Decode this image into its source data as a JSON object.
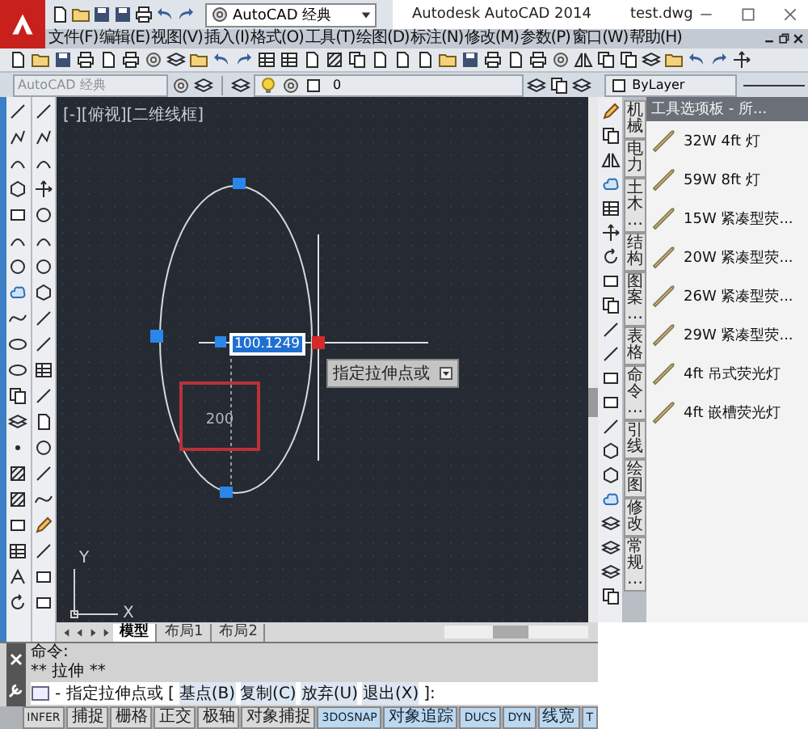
{
  "app": {
    "workspace": "AutoCAD 经典",
    "title": "Autodesk AutoCAD 2014",
    "file": "test.dwg"
  },
  "menu": [
    "文件(F)",
    "编辑(E)",
    "视图(V)",
    "插入(I)",
    "格式(O)",
    "工具(T)",
    "绘图(D)",
    "标注(N)",
    "修改(M)",
    "参数(P)",
    "窗口(W)",
    "帮助(H)"
  ],
  "toolbar": {
    "workspace": "AutoCAD 经典",
    "layer": "0",
    "color_control": "ByLayer"
  },
  "viewport": {
    "label": "[-][俯视][二维线框]"
  },
  "drawing": {
    "dynamic_input": "100.1249",
    "tooltip": "指定拉伸点或",
    "dimension": "200",
    "ucs_y": "Y",
    "ucs_x": "X"
  },
  "layout_tabs": [
    {
      "label": "模型",
      "selected": true
    },
    {
      "label": "布局1",
      "selected": false
    },
    {
      "label": "布局2",
      "selected": false
    }
  ],
  "palette": {
    "title": "工具选项板 - 所...",
    "tabs": [
      "机械",
      "电力",
      "土木…",
      "结构",
      "图案…",
      "表格",
      "命令…",
      "引线",
      "绘图",
      "修改",
      "常规…"
    ],
    "items": [
      "32W 4ft 灯",
      "59W 8ft 灯",
      "15W 紧凑型荧...",
      "20W 紧凑型荧...",
      "26W 紧凑型荧...",
      "29W 紧凑型荧...",
      "4ft 吊式荧光灯",
      "4ft 嵌槽荧光灯"
    ]
  },
  "command": {
    "history": [
      "命令:",
      "** 拉伸 **"
    ],
    "prompt": "- 指定拉伸点或 [",
    "options": [
      "基点(B)",
      "复制(C)",
      "放弃(U)",
      "退出(X)"
    ],
    "suffix": "]:"
  },
  "status_bar": [
    {
      "label": "INFER",
      "on": false
    },
    {
      "label": "捕捉",
      "on": false
    },
    {
      "label": "栅格",
      "on": false
    },
    {
      "label": "正交",
      "on": false
    },
    {
      "label": "极轴",
      "on": false
    },
    {
      "label": "对象捕捉",
      "on": false
    },
    {
      "label": "3DOSNAP",
      "on": true
    },
    {
      "label": "对象追踪",
      "on": true
    },
    {
      "label": "DUCS",
      "on": true
    },
    {
      "label": "DYN",
      "on": true
    },
    {
      "label": "线宽",
      "on": true
    },
    {
      "label": "T",
      "on": true
    }
  ]
}
